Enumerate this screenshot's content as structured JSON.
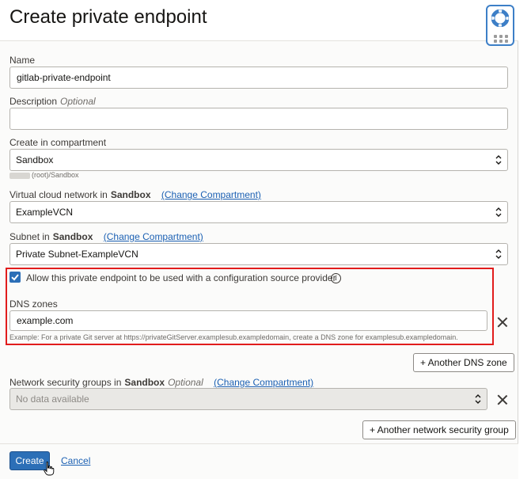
{
  "header": {
    "title": "Create private endpoint"
  },
  "help": {
    "icon": "lifebuoy-icon",
    "accent": "#3d7fc7"
  },
  "name": {
    "label": "Name",
    "value": "gitlab-private-endpoint"
  },
  "description": {
    "label": "Description",
    "optional": "Optional",
    "value": ""
  },
  "compartment": {
    "label": "Create in compartment",
    "value": "Sandbox",
    "path": "(root)/Sandbox"
  },
  "vcn": {
    "label": "Virtual cloud network in",
    "compartment": "Sandbox",
    "change_link": "(Change Compartment)",
    "value": "ExampleVCN"
  },
  "subnet": {
    "label": "Subnet in",
    "compartment": "Sandbox",
    "change_link": "(Change Compartment)",
    "value": "Private Subnet-ExampleVCN"
  },
  "config_source": {
    "checked": true,
    "label": "Allow this private endpoint to be used with a configuration source provider",
    "info_icon": "i"
  },
  "dns": {
    "label": "DNS zones",
    "value": "example.com",
    "hint": "Example: For a private Git server at https://privateGitServer.examplesub.exampledomain, create a DNS zone for examplesub.exampledomain.",
    "add_button": "+ Another DNS zone"
  },
  "nsg": {
    "label": "Network security groups in",
    "compartment": "Sandbox",
    "optional": "Optional",
    "change_link": "(Change Compartment)",
    "placeholder": "No data available",
    "add_button": "+ Another network security group"
  },
  "footer": {
    "create_label": "Create",
    "cancel_label": "Cancel"
  },
  "colors": {
    "primary": "#2c6fb7",
    "link": "#1b60b3",
    "highlight": "#e11c1c"
  }
}
